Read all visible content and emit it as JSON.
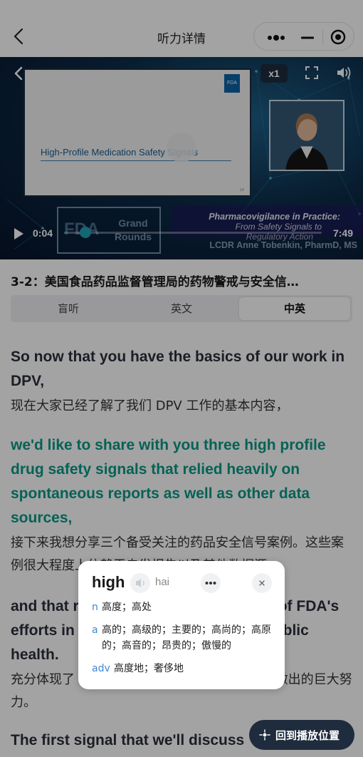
{
  "header": {
    "title": "听力详情"
  },
  "video": {
    "speed": "x1",
    "slide_title": "High-Profile Medication Safety Signals",
    "fda_logo": "FDA",
    "slide_page": "14",
    "grand_rounds": {
      "logo": "FDA",
      "text": "Grand Rounds"
    },
    "program_title": "Pharmacovigilance in Practice:",
    "program_subtitle": "From Safety Signals to",
    "program_subtitle2": "Regulatory Action",
    "presenter": "LCDR Anne Tobenkin, PharmD, MS",
    "current_time": "0:04",
    "total_time": "7:49",
    "progress_fraction": 0.0085
  },
  "episode_title": "3-2：美国食品药品监督管理局的药物警戒与安全信…",
  "tabs": [
    "盲听",
    "英文",
    "中英"
  ],
  "active_tab": "中英",
  "transcript": [
    {
      "en": "So now that you have the basics of our work in DPV,",
      "zh": "现在大家已经了解了我们 DPV 工作的基本内容，"
    },
    {
      "en": "we'd like to share with you three high profile drug safety signals that relied heavily on spontaneous reports as well as other data sources,",
      "zh": "接下来我想分享三个备受关注的药品安全信号案例。这些案例很大程度上依赖于自发报告以及其他数据源，",
      "active": true
    },
    {
      "en": "and that reflect the significant efforts of FDA's efforts in protecting and promoting public health.",
      "zh": "充分体现了 FDA 在保护和促进公众健康方面所做出的巨大努力。"
    },
    {
      "en": "The first signal that we'll discuss",
      "zh": ""
    }
  ],
  "popup": {
    "word": "high",
    "phonetic": "hai",
    "definitions": [
      {
        "pos": "n",
        "meaning": "高度；高处"
      },
      {
        "pos": "a",
        "meaning": "高的；高级的；主要的；高尚的；高原的；高音的；昂贵的；傲慢的"
      },
      {
        "pos": "adv",
        "meaning": "高度地；奢侈地"
      }
    ]
  },
  "back_to_position": "回到播放位置",
  "colors": {
    "accent_green": "#0a9a86",
    "definition_blue": "#3f86d8",
    "dark_button": "#1f2c3e"
  }
}
